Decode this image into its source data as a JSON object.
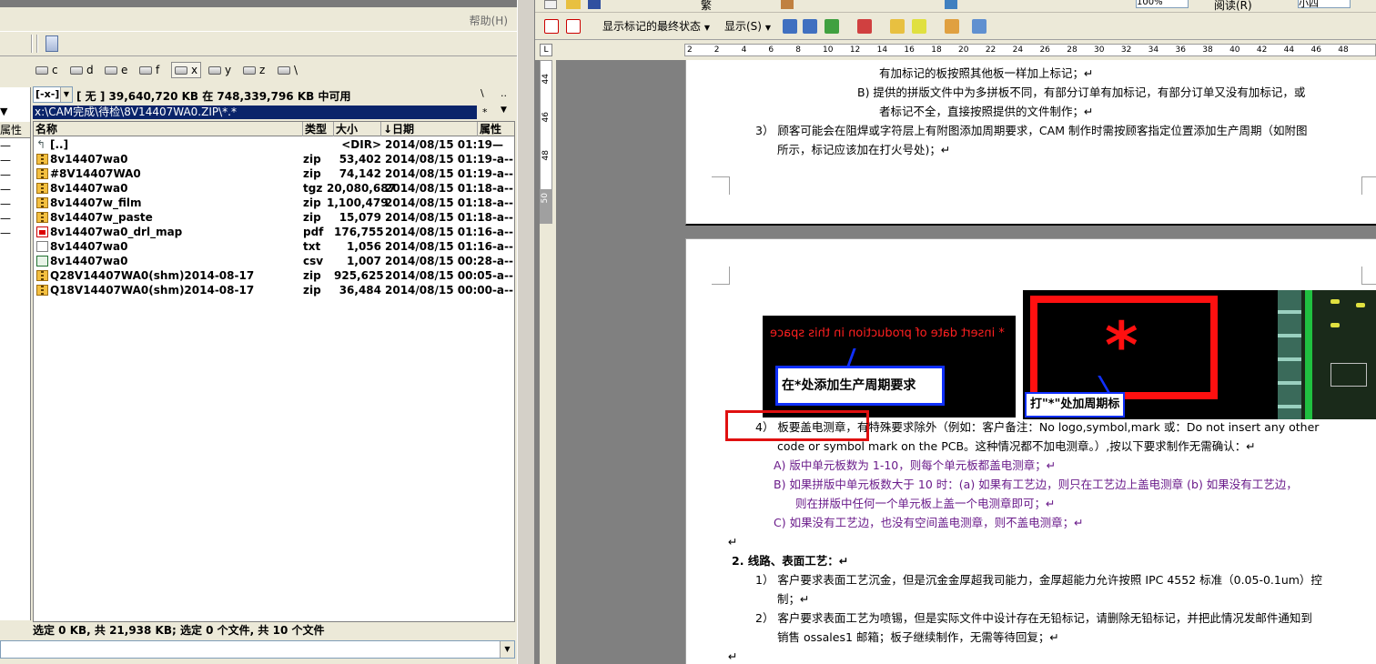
{
  "file_manager": {
    "help_menu": "帮助(H)",
    "drives": [
      "c",
      "d",
      "e",
      "f",
      "x",
      "y",
      "z",
      "\\"
    ],
    "active_drive": "x",
    "drive_select_value": "[-x-]",
    "free_space_text": "[ 无 ]  39,640,720 KB 在 748,339,796 KB 中可用",
    "path": "x:\\CAM完成\\待检\\8V14407WA0.ZIP\\*.*",
    "path_btn_root": "\\",
    "path_btn_up": "..",
    "path_btn_star": "*",
    "left_strip_header": "属性",
    "columns": {
      "name": "名称",
      "ext": "类型",
      "size": "大小",
      "date": "↓日期",
      "attr": "属性"
    },
    "files": [
      {
        "name": "[..]",
        "ext": "",
        "size": "<DIR>",
        "date": "2014/08/15 01:19—",
        "icon": "up-folder-icon"
      },
      {
        "name": "8v14407wa0",
        "ext": "zip",
        "size": "53,402",
        "date": "2014/08/15 01:19-a--",
        "icon": "zip-file-icon"
      },
      {
        "name": "#8V14407WA0",
        "ext": "zip",
        "size": "74,142",
        "date": "2014/08/15 01:19-a--",
        "icon": "zip-file-icon"
      },
      {
        "name": "8v14407wa0",
        "ext": "tgz",
        "size": "20,080,687",
        "date": "2014/08/15 01:18-a--",
        "icon": "zip-file-icon"
      },
      {
        "name": "8v14407w_film",
        "ext": "zip",
        "size": "1,100,479",
        "date": "2014/08/15 01:18-a--",
        "icon": "zip-file-icon"
      },
      {
        "name": "8v14407w_paste",
        "ext": "zip",
        "size": "15,079",
        "date": "2014/08/15 01:18-a--",
        "icon": "zip-file-icon"
      },
      {
        "name": "8v14407wa0_drl_map",
        "ext": "pdf",
        "size": "176,755",
        "date": "2014/08/15 01:16-a--",
        "icon": "pdf-file-icon"
      },
      {
        "name": "8v14407wa0",
        "ext": "txt",
        "size": "1,056",
        "date": "2014/08/15 01:16-a--",
        "icon": "txt-file-icon"
      },
      {
        "name": "8v14407wa0",
        "ext": "csv",
        "size": "1,007",
        "date": "2014/08/15 00:28-a--",
        "icon": "csv-file-icon"
      },
      {
        "name": "Q28V14407WA0(shm)2014-08-17",
        "ext": "zip",
        "size": "925,625",
        "date": "2014/08/15 00:05-a--",
        "icon": "zip-file-icon"
      },
      {
        "name": "Q18V14407WA0(shm)2014-08-17",
        "ext": "zip",
        "size": "36,484",
        "date": "2014/08/15 00:00-a--",
        "icon": "zip-file-icon"
      }
    ],
    "status": "选定 0 KB, 共 21,938 KB; 选定 0 个文件, 共 10 个文件"
  },
  "word": {
    "menu_top": "阅读(R)",
    "zoom": "100%",
    "font_size": "小四",
    "markup_state": "显示标记的最终状态",
    "show_button": "显示(S)",
    "ruler_ticks": [
      "2",
      "2",
      "4",
      "6",
      "8",
      "10",
      "12",
      "14",
      "16",
      "18",
      "20",
      "22",
      "24",
      "26",
      "28",
      "30",
      "32",
      "34",
      "36",
      "38",
      "40",
      "42",
      "44",
      "46",
      "48"
    ],
    "vruler_ticks": [
      "44",
      "46",
      "48",
      "50"
    ],
    "page1": {
      "line1": "有加标记的板按照其他板一样加上标记；↵",
      "line2": "B)  提供的拼版文件中为多拼板不同，有部分订单有加标记，有部分订单又没有加标记，或",
      "line3": "者标记不全，直接按照提供的文件制作；↵",
      "line4": "3） 顾客可能会在阻焊或字符层上有附图添加周期要求，CAM 制作时需按顾客指定位置添加生产周期（如附图",
      "line5": "所示，标记应该加在打火号处)；↵"
    },
    "page2": {
      "img1_red_text": "* insert date of production in this space",
      "img1_callout": "在*处添加生产周期要求",
      "img2_callout": "打\"*\"处加周期标",
      "img2_star": "*",
      "p4_line1": "4） 板要盖电测章，有特殊要求除外（例如：客户备注：No logo,symbol,mark 或：Do not insert any other",
      "p4_line2": "code or symbol mark on the PCB。这种情况都不加电测章。）,按以下要求制作无需确认：↵",
      "a_line": "A)  版中单元板数为 1-10，则每个单元板都盖电测章；↵",
      "b_line1": "B)  如果拼版中单元板数大于 10 时：(a) 如果有工艺边，则只在工艺边上盖电测章 (b) 如果没有工艺边，",
      "b_line2": "则在拼版中任何一个单元板上盖一个电测章即可；↵",
      "c_line": "C)  如果没有工艺边，也没有空间盖电测章，则不盖电测章；↵",
      "blank1": "↵",
      "section2": "2.   线路、表面工艺：↵",
      "s1_line1": "1） 客户要求表面工艺沉金，但是沉金金厚超我司能力，金厚超能力允许按照 IPC 4552 标准（0.05-0.1um）控",
      "s1_line2": "制；↵",
      "s2_line1": "2） 客户要求表面工艺为喷锡，但是实际文件中设计存在无铅标记，请删除无铅标记，并把此情况发邮件通知到",
      "s2_line2": "销售 ossales1 邮箱；板子继续制作，无需等待回复；↵",
      "blank2": "↵"
    }
  }
}
